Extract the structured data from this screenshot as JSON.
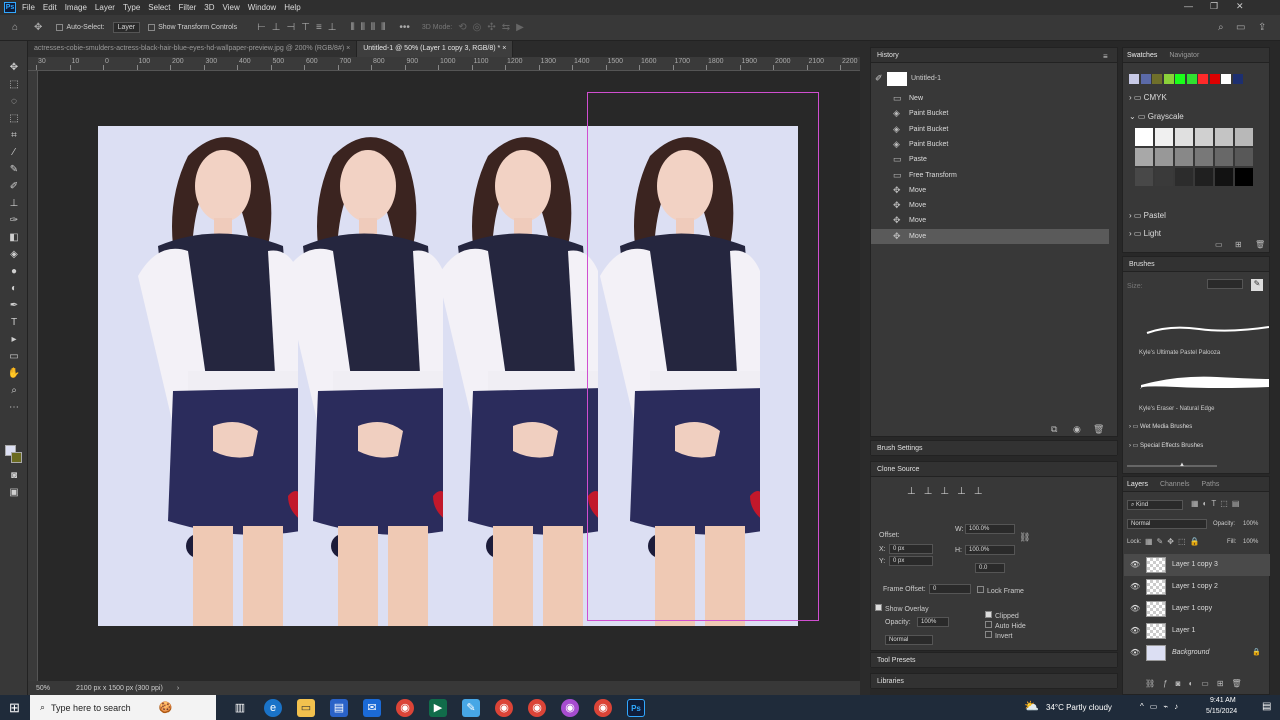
{
  "menu": [
    "File",
    "Edit",
    "Image",
    "Layer",
    "Type",
    "Select",
    "Filter",
    "3D",
    "View",
    "Window",
    "Help"
  ],
  "options_bar": {
    "auto_select_label": "Auto-Select:",
    "auto_select_value": "Layer",
    "transform_label": "Show Transform Controls",
    "mode_3d": "3D Mode:"
  },
  "tabs": [
    {
      "label": "actresses-cobie-smulders-actress-black-hair-blue-eyes-hd-wallpaper-preview.jpg @ 200% (RGB/8#)"
    },
    {
      "label": "Untitled-1 @ 50% (Layer 1 copy 3, RGB/8) *"
    }
  ],
  "ruler": [
    "30",
    "10",
    "0",
    "100",
    "200",
    "300",
    "400",
    "500",
    "600",
    "700",
    "800",
    "900",
    "1000",
    "1100",
    "1200",
    "1300",
    "1400",
    "1500",
    "1600",
    "1700",
    "1800",
    "1900",
    "2000",
    "2100",
    "2200"
  ],
  "status": {
    "zoom": "50%",
    "size": "2100 px x 1500 px (300 ppi)"
  },
  "history": {
    "title": "History",
    "snapshot": "Untitled-1",
    "items": [
      "New",
      "Paint Bucket",
      "Paint Bucket",
      "Paint Bucket",
      "Paste",
      "Free Transform",
      "Move",
      "Move",
      "Move",
      "Move"
    ]
  },
  "swatches": {
    "tabs": [
      "Swatches",
      "Navigator"
    ],
    "colors": [
      "#c7c9e6",
      "#5b6aa8",
      "#6f6f2a",
      "#8bd13a",
      "#1aff1a",
      "#30e030",
      "#ff2a2a",
      "#dd0000",
      "#ffffff",
      "#1d2f70"
    ],
    "folders": [
      "CMYK",
      "Grayscale",
      "Pastel",
      "Light"
    ],
    "grays": [
      "#ffffff",
      "#f0f0f0",
      "#e0e0e0",
      "#d0d0d0",
      "#c4c4c4",
      "#b8b8b8",
      "#a8a8a8",
      "#989898",
      "#888888",
      "#787878",
      "#686868",
      "#585858",
      "#484848",
      "#3a3a3a",
      "#2c2c2c",
      "#202020",
      "#121212",
      "#000000"
    ]
  },
  "brushes": {
    "title": "Brushes",
    "size_label": "Size:",
    "items": [
      "Kyle's Ultimate Pastel Palooza",
      "Kyle's Eraser - Natural Edge"
    ],
    "folders": [
      "Wet Media Brushes",
      "Special Effects Brushes"
    ]
  },
  "brush_settings": {
    "title": "Brush Settings"
  },
  "clone_source": {
    "title": "Clone Source",
    "offset": "Offset:",
    "x": "X:",
    "x_val": "0 px",
    "y": "Y:",
    "y_val": "0 px",
    "w": "W:",
    "w_val": "100.0%",
    "h": "H:",
    "h_val": "100.0%",
    "angle_val": "0.0",
    "frame_offset": "Frame Offset:",
    "frame_val": "0",
    "lock_frame": "Lock Frame",
    "show_overlay": "Show Overlay",
    "opacity": "Opacity:",
    "opacity_val": "100%",
    "mode": "Normal",
    "clipped": "Clipped",
    "auto_hide": "Auto Hide",
    "invert": "Invert"
  },
  "tool_presets": "Tool Presets",
  "libraries": "Libraries",
  "layers": {
    "tabs": [
      "Layers",
      "Channels",
      "Paths"
    ],
    "kind": "Kind",
    "blend": "Normal",
    "opacity_label": "Opacity:",
    "opacity": "100%",
    "lock_label": "Lock:",
    "fill_label": "Fill:",
    "fill": "100%",
    "items": [
      "Layer 1 copy 3",
      "Layer 1 copy 2",
      "Layer 1 copy",
      "Layer 1",
      "Background"
    ]
  },
  "taskbar": {
    "search_placeholder": "Type here to search",
    "weather": "34°C  Partly cloudy",
    "time": "9:41 AM",
    "date": "5/15/2024"
  },
  "colors": {
    "accent": "#31a8ff",
    "selection": "#d04ed0",
    "canvas_bg": "#dcdff3",
    "skirt": "#2b2c5c",
    "jacket": "#25263f"
  }
}
